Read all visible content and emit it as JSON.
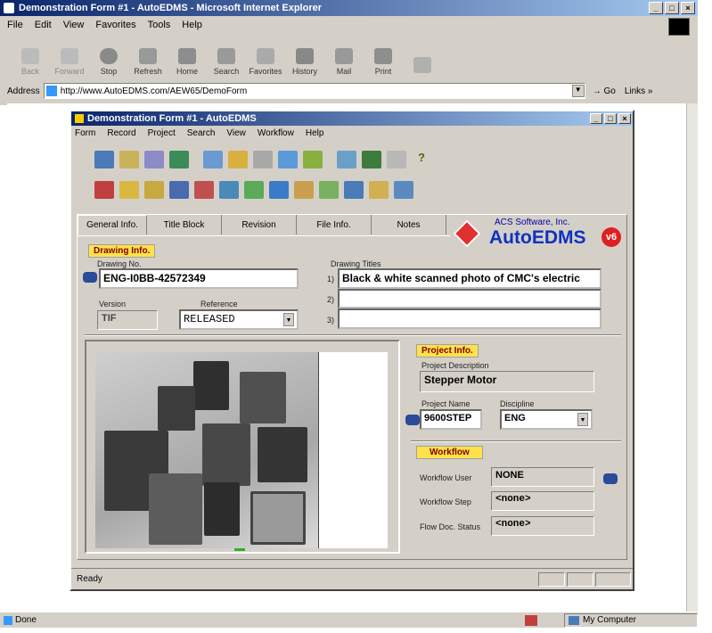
{
  "browser": {
    "title": "Demonstration Form #1 - AutoEDMS - Microsoft Internet Explorer",
    "menu": [
      "File",
      "Edit",
      "View",
      "Favorites",
      "Tools",
      "Help"
    ],
    "toolbar": [
      {
        "label": "Back",
        "icon": "back-arrow-icon"
      },
      {
        "label": "Forward",
        "icon": "forward-arrow-icon"
      },
      {
        "label": "Stop",
        "icon": "stop-icon"
      },
      {
        "label": "Refresh",
        "icon": "refresh-icon"
      },
      {
        "label": "Home",
        "icon": "home-icon"
      },
      {
        "label": "Search",
        "icon": "search-icon"
      },
      {
        "label": "Favorites",
        "icon": "favorites-icon"
      },
      {
        "label": "History",
        "icon": "history-icon"
      },
      {
        "label": "Mail",
        "icon": "mail-icon"
      },
      {
        "label": "Print",
        "icon": "print-icon"
      }
    ],
    "address_label": "Address",
    "url": "http://www.AutoEDMS.com/AEW65/DemoForm",
    "go_label": "Go",
    "links_label": "Links »",
    "status_text": "Done",
    "zone_text": "My Computer"
  },
  "app": {
    "title": "Demonstration Form #1 - AutoEDMS",
    "menu": [
      "Form",
      "Record",
      "Project",
      "Search",
      "View",
      "Workflow",
      "Help"
    ],
    "tabs": [
      "General Info.",
      "Title Block",
      "Revision",
      "File Info.",
      "Notes"
    ],
    "brand_company": "ACS Software, Inc.",
    "brand_name": "AutoEDMS",
    "brand_version": "v6",
    "drawing_info_label": "Drawing Info.",
    "drawing_no_label": "Drawing No.",
    "drawing_no": "ENG-I0BB-42572349",
    "version_label": "Version",
    "version_value": "TIF",
    "reference_label": "Reference",
    "reference_value": "RELEASED",
    "drawing_titles_label": "Drawing Titles",
    "titles": [
      {
        "num": "1)",
        "value": "Black & white scanned photo of CMC's electric"
      },
      {
        "num": "2)",
        "value": ""
      },
      {
        "num": "3)",
        "value": ""
      }
    ],
    "project_info_label": "Project Info.",
    "project_desc_label": "Project Description",
    "project_desc": "Stepper Motor",
    "project_name_label": "Project Name",
    "project_name": "9600STEP",
    "discipline_label": "Discipline",
    "discipline": "ENG",
    "workflow_label": "Workflow",
    "wf_user_label": "Workflow User",
    "wf_user": "NONE",
    "wf_step_label": "Workflow Step",
    "wf_step": "<none>",
    "flow_status_label": "Flow Doc. Status",
    "flow_status": "<none>",
    "status_text": "Ready",
    "toolbar_row1": [
      "new-form-icon",
      "edit-icon",
      "copy-icon",
      "tree-icon",
      "checkout-icon",
      "checkin-icon",
      "disk-icon",
      "transfer-icon",
      "view-icon",
      "undo-icon",
      "export-icon",
      "page-icon",
      "help-icon"
    ],
    "toolbar_row2": [
      "delete-icon",
      "folder-open-icon",
      "folder-icon",
      "save-icon",
      "edit-form-icon",
      "structure-icon",
      "network-icon",
      "stack-icon",
      "pen-icon",
      "chart-icon",
      "archive-icon",
      "move-icon",
      "import-icon"
    ]
  }
}
